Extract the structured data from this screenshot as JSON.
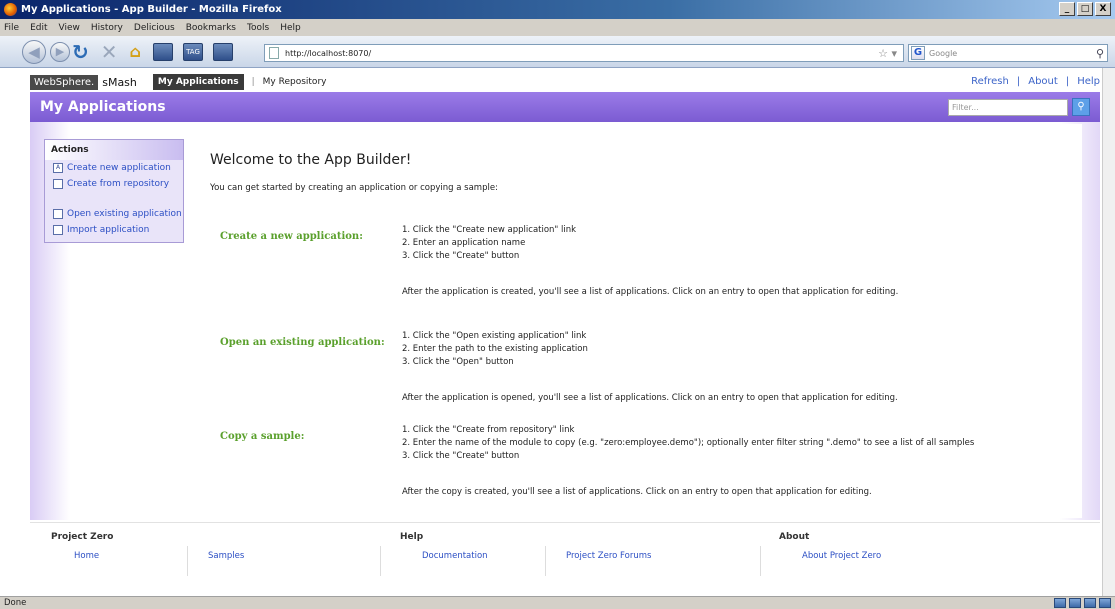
{
  "window": {
    "title": "My Applications - App Builder - Mozilla Firefox",
    "buttons": [
      "_",
      "□",
      "X"
    ]
  },
  "menu": {
    "items": [
      "File",
      "Edit",
      "View",
      "History",
      "Delicious",
      "Bookmarks",
      "Tools",
      "Help"
    ]
  },
  "browser": {
    "url": "http://localhost:8070/",
    "search_placeholder": "Google",
    "tag_label": "TAG"
  },
  "app": {
    "brand": "WebSphere.",
    "brand_product": "sMash",
    "tabs": [
      "My Applications",
      "My Repository"
    ],
    "links": [
      "Refresh",
      "About",
      "Help"
    ],
    "page_title": "My Applications",
    "filter_placeholder": "Filter..."
  },
  "actions": {
    "heading": "Actions",
    "items": [
      "Create new application",
      "Create from repository",
      "Open existing application",
      "Import application"
    ]
  },
  "main": {
    "welcome": "Welcome to the App Builder!",
    "intro": "You can get started by creating an application or copying a sample:",
    "sections": [
      {
        "title": "Create a new application:",
        "steps": [
          "1.  Click the \"Create new application\" link",
          "2.  Enter an application name",
          "3.  Click the \"Create\" button"
        ],
        "after": "After the application is created, you'll see a list of applications. Click on an entry to open that application for editing."
      },
      {
        "title": "Open an existing application:",
        "steps": [
          "1.  Click the \"Open existing application\" link",
          "2.  Enter the path to the existing application",
          "3.  Click the \"Open\" button"
        ],
        "after": "After the application is opened, you'll see a list of applications. Click on an entry to open that application for editing."
      },
      {
        "title": "Copy a sample:",
        "steps": [
          "1.  Click the \"Create from repository\" link",
          "2.  Enter the name of the module to copy (e.g. \"zero:employee.demo\"); optionally enter filter string \".demo\" to see a list of all samples",
          "3.  Click the \"Create\" button"
        ],
        "after": "After the copy is created, you'll see a list of applications. Click on an entry to open that application for editing."
      }
    ]
  },
  "footer": {
    "columns": [
      {
        "title": "Project Zero",
        "links": [
          "Home",
          "Samples"
        ]
      },
      {
        "title": "Help",
        "links": [
          "Documentation",
          "Project Zero Forums"
        ]
      },
      {
        "title": "About",
        "links": [
          "About Project Zero"
        ]
      }
    ]
  },
  "status": {
    "text": "Done"
  }
}
